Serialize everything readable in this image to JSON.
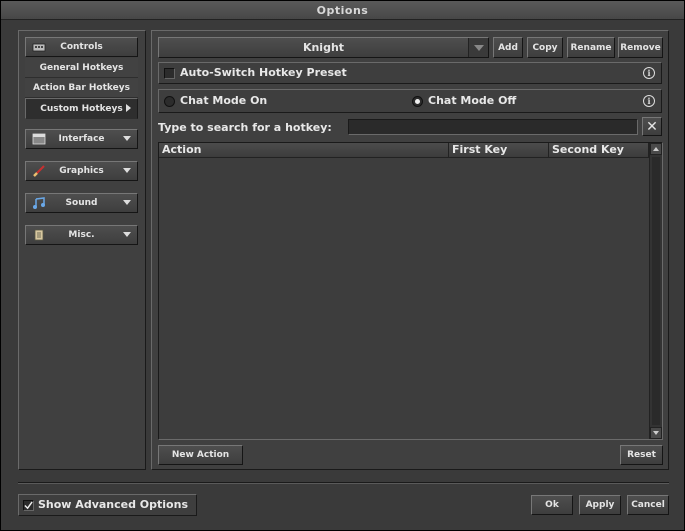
{
  "window": {
    "title": "Options"
  },
  "sidebar": {
    "controls_label": "Controls",
    "sub_items": [
      "General Hotkeys",
      "Action Bar Hotkeys",
      "Custom Hotkeys"
    ],
    "interface_label": "Interface",
    "graphics_label": "Graphics",
    "sound_label": "Sound",
    "misc_label": "Misc."
  },
  "preset": {
    "selected": "Knight",
    "add_label": "Add",
    "copy_label": "Copy",
    "rename_label": "Rename",
    "remove_label": "Remove"
  },
  "options": {
    "auto_switch_label": "Auto-Switch Hotkey Preset",
    "auto_switch_checked": false,
    "chat_on_label": "Chat Mode On",
    "chat_off_label": "Chat Mode Off",
    "chat_mode_selected": "off",
    "info_glyph": "i"
  },
  "search": {
    "label": "Type to search for a hotkey:",
    "value": "",
    "clear_glyph": "✕"
  },
  "table": {
    "columns": [
      "Action",
      "First Key",
      "Second Key"
    ],
    "rows": []
  },
  "actions": {
    "new_action_label": "New Action",
    "reset_label": "Reset"
  },
  "footer": {
    "show_advanced_label": "Show Advanced Options",
    "show_advanced_checked": true,
    "ok_label": "Ok",
    "apply_label": "Apply",
    "cancel_label": "Cancel"
  },
  "colors": {
    "window_bg": "#3a3a3a",
    "panel_bg": "#404040",
    "table_bg": "#3d3d3d",
    "text": "#e8e8e8"
  }
}
